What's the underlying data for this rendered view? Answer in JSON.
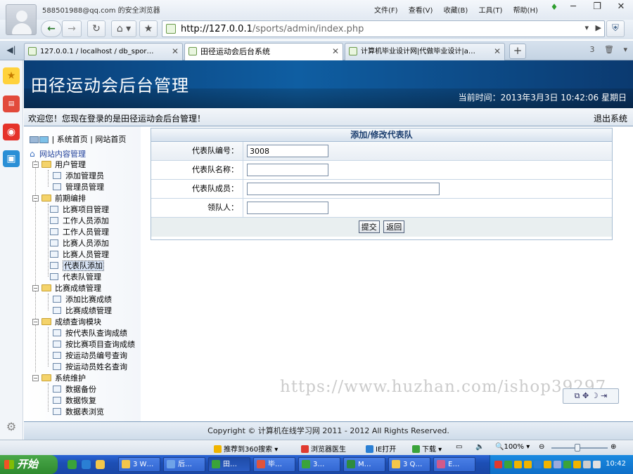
{
  "browser": {
    "account": "588501988@qq.com 的安全浏览器",
    "menu": [
      "文件(F)",
      "查看(V)",
      "收藏(B)",
      "工具(T)",
      "帮助(H)"
    ],
    "url_host": "http://127.0.0.1",
    "url_path": "/sports/admin/index.php",
    "tabs": [
      {
        "label": "127.0.0.1 / localhost / db_spor…"
      },
      {
        "label": "田径运动会后台系统"
      },
      {
        "label": "计算机毕业设计网|代做毕业设计|a…"
      }
    ],
    "tab_tools_count": "3"
  },
  "header": {
    "title": "田径运动会后台管理",
    "datetime": "当前时间：2013年3月3日 10:42:06 星期日"
  },
  "welcome": {
    "text": "欢迎您！您现在登录的是田径运动会后台管理！",
    "logout": "退出系统"
  },
  "menu": {
    "top_links": [
      "系统首页",
      "网站首页"
    ],
    "root": "网站内容管理",
    "categories": [
      {
        "label": "用户管理",
        "items": [
          "添加管理员",
          "管理员管理"
        ]
      },
      {
        "label": "前期编排",
        "items": [
          "比赛项目管理",
          "工作人员添加",
          "工作人员管理",
          "比赛人员添加",
          "比赛人员管理",
          "代表队添加",
          "代表队管理"
        ]
      },
      {
        "label": "比赛成绩管理",
        "items": [
          "添加比赛成绩",
          "比赛成绩管理"
        ]
      },
      {
        "label": "成绩查询模块",
        "items": [
          "按代表队查询成绩",
          "按比赛项目查询成绩",
          "按运动员编号查询",
          "按运动员姓名查询"
        ]
      },
      {
        "label": "系统维护",
        "items": [
          "数据备份",
          "数据恢复",
          "数据表浏览"
        ]
      }
    ],
    "selected": "代表队添加"
  },
  "form": {
    "title": "添加/修改代表队",
    "fields": [
      {
        "label": "代表队编号：",
        "value": "3008"
      },
      {
        "label": "代表队名称：",
        "value": ""
      },
      {
        "label": "代表队成员：",
        "value": ""
      },
      {
        "label": "领队人：",
        "value": ""
      }
    ],
    "submit": "提交",
    "back": "返回"
  },
  "watermark": "https://www.huzhan.com/ishop39297",
  "footer": "Copyright © 计算机在线学习网 2011 - 2012 All Rights Reserved.",
  "statusbar": {
    "search360": "推荐到360搜索",
    "doctor": "浏览器医生",
    "ie_open": "IE打开",
    "download": "下载",
    "zoom": "100%"
  },
  "taskbar": {
    "start": "开始",
    "tasks": [
      "3 W…",
      "后…",
      "田…",
      "毕…",
      "3…",
      "M…",
      "3 Q…",
      "E…"
    ],
    "clock": "10:42"
  }
}
